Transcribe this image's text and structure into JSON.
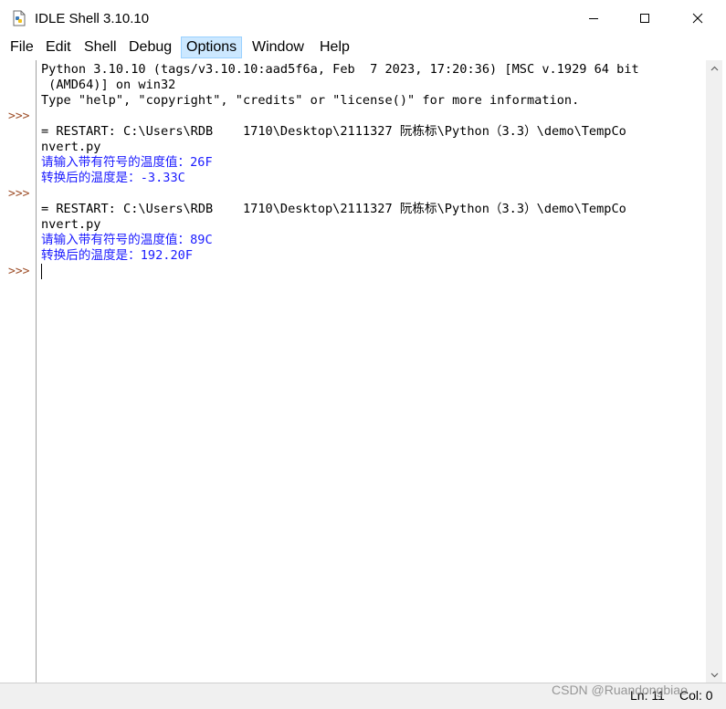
{
  "window": {
    "title": "IDLE Shell 3.10.10"
  },
  "menu": {
    "items": [
      "File",
      "Edit",
      "Shell",
      "Debug",
      "Options",
      "Window",
      "Help"
    ],
    "active": "Options"
  },
  "shell": {
    "prompt": ">>>",
    "lines": [
      "Python 3.10.10 (tags/v3.10.10:aad5f6a, Feb  7 2023, 17:20:36) [MSC v.1929 64 bit",
      " (AMD64)] on win32",
      "Type \"help\", \"copyright\", \"credits\" or \"license()\" for more information.",
      "= RESTART: C:\\Users\\RDB    1710\\Desktop\\2111327 阮栋标\\Python（3.3）\\demo\\TempCo",
      "nvert.py",
      "请输入带有符号的温度值：26F",
      "转换后的温度是：-3.33C",
      "= RESTART: C:\\Users\\RDB    1710\\Desktop\\2111327 阮栋标\\Python（3.3）\\demo\\TempCo",
      "nvert.py",
      "请输入带有符号的温度值：89C",
      "转换后的温度是：192.20F"
    ]
  },
  "status": {
    "line": "Ln: 11",
    "col": "Col: 0"
  },
  "watermark": "CSDN @Ruandongbiao",
  "colors": {
    "prompt": "#a0522d",
    "output_blue": "#1a1aff",
    "menu_highlight": "#cce8ff"
  }
}
